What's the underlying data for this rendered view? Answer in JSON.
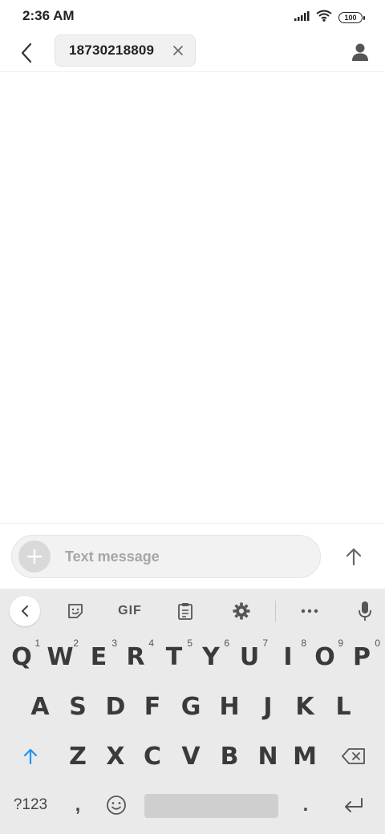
{
  "status_bar": {
    "time": "2:36 AM",
    "battery": "100",
    "icons": [
      "signal-icon",
      "wifi-icon",
      "battery-icon"
    ]
  },
  "top_bar": {
    "back_icon": "back-arrow-icon",
    "recipient": "18730218809",
    "chip_close_icon": "close-icon",
    "contact_icon": "contact-person-icon"
  },
  "compose": {
    "add_icon": "plus-icon",
    "placeholder": "Text message",
    "send_icon": "send-arrow-icon"
  },
  "keyboard": {
    "toolbar": {
      "collapse_icon": "chevron-left-icon",
      "sticker_icon": "sticker-icon",
      "gif_label": "GIF",
      "clipboard_icon": "clipboard-icon",
      "settings_icon": "gear-icon",
      "more_icon": "more-dots-icon",
      "mic_icon": "mic-icon"
    },
    "row1": [
      {
        "key": "Q",
        "hint": "1"
      },
      {
        "key": "W",
        "hint": "2"
      },
      {
        "key": "E",
        "hint": "3"
      },
      {
        "key": "R",
        "hint": "4"
      },
      {
        "key": "T",
        "hint": "5"
      },
      {
        "key": "Y",
        "hint": "6"
      },
      {
        "key": "U",
        "hint": "7"
      },
      {
        "key": "I",
        "hint": "8"
      },
      {
        "key": "O",
        "hint": "9"
      },
      {
        "key": "P",
        "hint": "0"
      }
    ],
    "row2": [
      "A",
      "S",
      "D",
      "F",
      "G",
      "H",
      "J",
      "K",
      "L"
    ],
    "row3": [
      "Z",
      "X",
      "C",
      "V",
      "B",
      "N",
      "M"
    ],
    "shift_icon": "shift-arrow-icon",
    "backspace_icon": "backspace-icon",
    "symbols_label": "?123",
    "comma_label": ",",
    "emoji_icon": "emoji-icon",
    "period_label": ".",
    "enter_icon": "enter-icon"
  },
  "colors": {
    "accent": "#2196f3",
    "keyboard_bg": "#eaeaea",
    "key_text": "#3a3a3a"
  }
}
